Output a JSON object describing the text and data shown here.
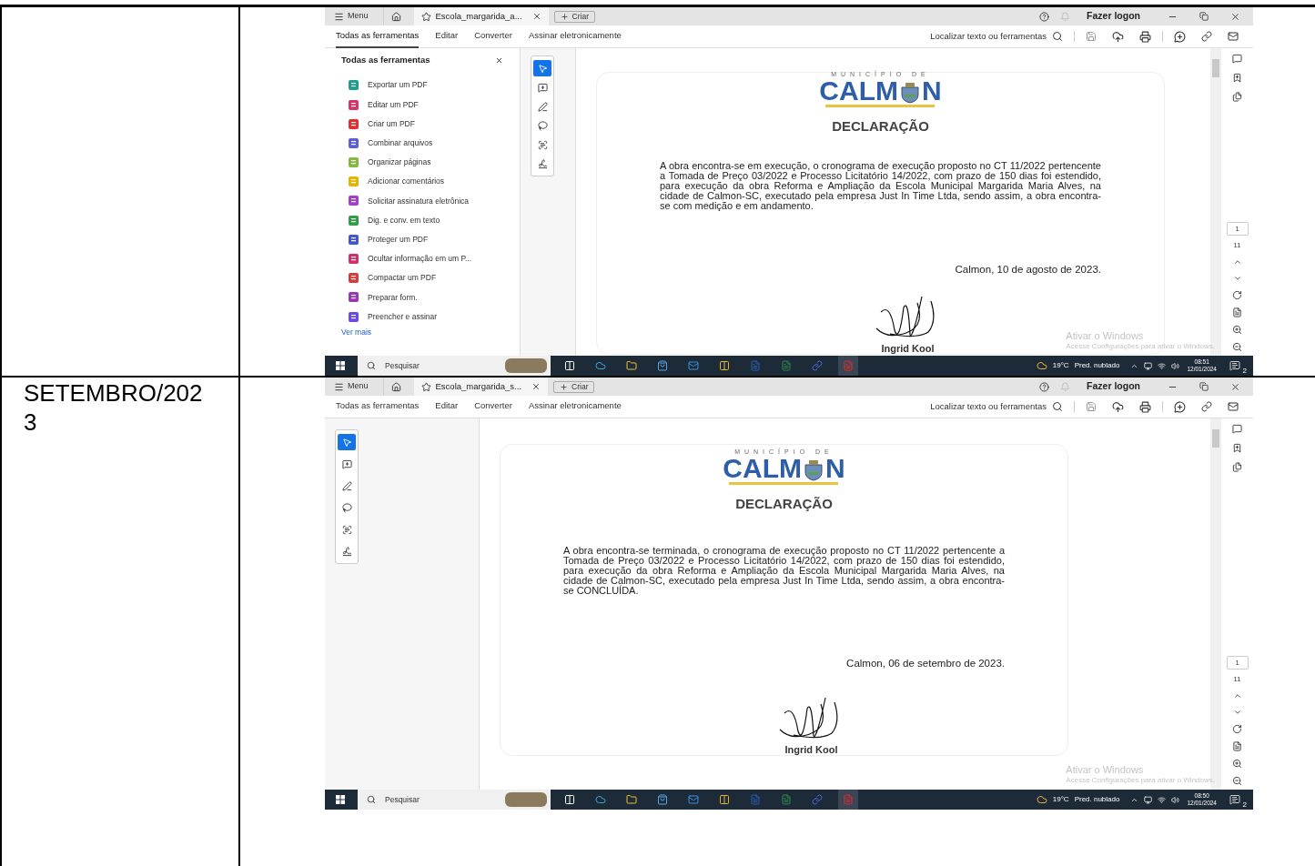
{
  "rows": [
    {
      "screenshot": {
        "menu": "Menu",
        "tab_title": "Escola_margarida_a...",
        "create": "Criar",
        "login": "Fazer logon",
        "toolbar_tabs": [
          {
            "label": "Todas as ferramentas",
            "selected": true
          },
          {
            "label": "Editar",
            "selected": false
          },
          {
            "label": "Converter",
            "selected": false
          },
          {
            "label": "Assinar eletronicamente",
            "selected": false
          }
        ],
        "search": "Localizar texto ou ferramentas",
        "tools_panel": {
          "title": "Todas as ferramentas",
          "items": [
            {
              "label": "Exportar um PDF",
              "color": "#1f9e8f"
            },
            {
              "label": "Editar um PDF",
              "color": "#d6336c"
            },
            {
              "label": "Criar um PDF",
              "color": "#e03131"
            },
            {
              "label": "Combinar arquivos",
              "color": "#5c5fd6"
            },
            {
              "label": "Organizar páginas",
              "color": "#82b940"
            },
            {
              "label": "Adicionar comentários",
              "color": "#e5b400"
            },
            {
              "label": "Solicitar assinatura eletrônica",
              "color": "#a33fc8"
            },
            {
              "label": "Dig. e conv. em texto",
              "color": "#2f9e44"
            },
            {
              "label": "Proteger um PDF",
              "color": "#4057d0"
            },
            {
              "label": "Ocultar informação em um P...",
              "color": "#d0306a"
            },
            {
              "label": "Compactar um PDF",
              "color": "#d93a3a"
            },
            {
              "label": "Preparar form.",
              "color": "#9b37b4"
            },
            {
              "label": "Preencher e assinar",
              "color": "#6d48e6"
            }
          ],
          "more": "Ver mais"
        },
        "doc": {
          "municipio": "MUNICÍPIO DE",
          "logo_left": "CALM",
          "logo_right": "N",
          "title": "DECLARAÇÃO",
          "body": "A obra encontra-se em execução, o cronograma de execução proposto no CT 11/2022 pertencente a Tomada de Preço 03/2022 e Processo Licitatório 14/2022, com prazo de 150 dias foi estendido, para execução da obra Reforma e Ampliação da Escola Municipal Margarida Maria Alves, na cidade de Calmon-SC, executado pela empresa Just In Time Ltda, sendo assim, a obra encontra-se com medição e em andamento.",
          "date_line": "Calmon, 10 de agosto de 2023.",
          "signer": "Ingrid Kool"
        },
        "page_number": "1",
        "page_count": "11",
        "activation_title": "Ativar o Windows",
        "activation_text": "Acesse Configurações para ativar o Windows.",
        "taskbar": {
          "search": "Pesquisar",
          "temperature": "19°C",
          "weather": "Pred. nublado",
          "time": "08:51",
          "date": "12/01/2024",
          "notifications": "2"
        }
      }
    },
    {
      "label": "SETEMBRO/2023",
      "screenshot": {
        "menu": "Menu",
        "tab_title": "Escola_margarida_s...",
        "create": "Criar",
        "login": "Fazer logon",
        "toolbar_tabs": [
          {
            "label": "Todas as ferramentas",
            "selected": false
          },
          {
            "label": "Editar",
            "selected": false
          },
          {
            "label": "Converter",
            "selected": false
          },
          {
            "label": "Assinar eletronicamente",
            "selected": false
          }
        ],
        "search": "Localizar texto ou ferramentas",
        "doc": {
          "municipio": "MUNICÍPIO DE",
          "logo_left": "CALM",
          "logo_right": "N",
          "title": "DECLARAÇÃO",
          "body": "A obra encontra-se terminada, o cronograma de execução proposto no CT 11/2022 pertencente a Tomada de Preço 03/2022 e Processo Licitatório 14/2022, com prazo de 150 dias foi estendido, para execução da obra Reforma e Ampliação da Escola Municipal Margarida Maria Alves, na cidade de Calmon-SC, executado pela empresa Just In Time Ltda, sendo assim, a obra encontra-se CONCLUÍDA.",
          "date_line": "Calmon, 06 de setembro de 2023.",
          "signer": "Ingrid Kool"
        },
        "page_number": "1",
        "page_count": "11",
        "activation_title": "Ativar o Windows",
        "activation_text": "Acesse Configurações para ativar o Windows.",
        "taskbar": {
          "search": "Pesquisar",
          "temperature": "19°C",
          "weather": "Pred. nublado",
          "time": "08:50",
          "date": "12/01/2024",
          "notifications": "2"
        }
      }
    }
  ]
}
